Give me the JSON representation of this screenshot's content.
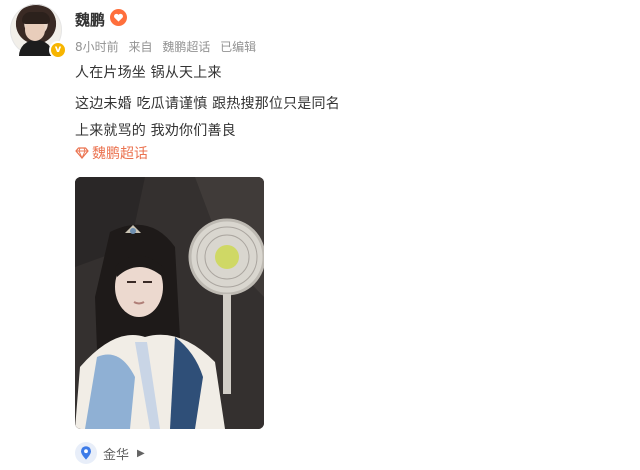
{
  "post": {
    "username": "魏鹏",
    "time": "8小时前",
    "source_prefix": "来自",
    "source": "魏鹏超话",
    "edited": "已编辑",
    "lines": [
      "人在片场坐 锅从天上来",
      "这边未婚 吃瓜请谨慎 跟热搜那位只是同名",
      "上来就骂的 我劝你们善良"
    ],
    "topic": "魏鹏超话",
    "location": "金华"
  },
  "icons": {
    "badge": "verified-v-icon",
    "emoji": "heart-eyes-badge-icon",
    "topic": "diamond-icon",
    "location": "location-pin-icon",
    "arrow": "triangle-right-icon"
  },
  "colors": {
    "topic": "#eb7350",
    "meta": "#939393",
    "badge": "#f7b500",
    "pin": "#3d7be8"
  }
}
